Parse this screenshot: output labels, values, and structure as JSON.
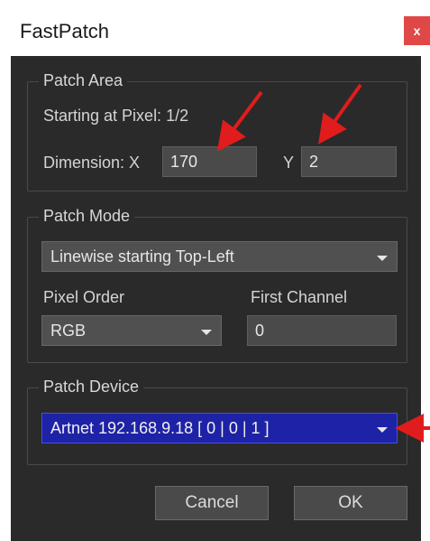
{
  "window": {
    "title": "FastPatch",
    "close_label": "x"
  },
  "patch_area": {
    "group_title": "Patch Area",
    "starting_text": "Starting at Pixel: 1/2",
    "dimension_x_label": "Dimension: X",
    "dimension_x_value": "170",
    "dimension_y_label": "Y",
    "dimension_y_value": "2"
  },
  "patch_mode": {
    "group_title": "Patch Mode",
    "mode_value": "Linewise starting Top-Left",
    "pixel_order_label": "Pixel Order",
    "pixel_order_value": "RGB",
    "first_channel_label": "First Channel",
    "first_channel_value": "0"
  },
  "patch_device": {
    "group_title": "Patch Device",
    "device_value": "Artnet 192.168.9.18 [ 0 | 0 | 1 ]"
  },
  "buttons": {
    "cancel_label": "Cancel",
    "ok_label": "OK"
  },
  "colors": {
    "dialog_bg": "#2a2a2a",
    "field_bg": "#4a4a4a",
    "selected_combo_bg": "#1e22a6",
    "arrow_red": "#e01c1c",
    "close_red": "#e04848"
  }
}
